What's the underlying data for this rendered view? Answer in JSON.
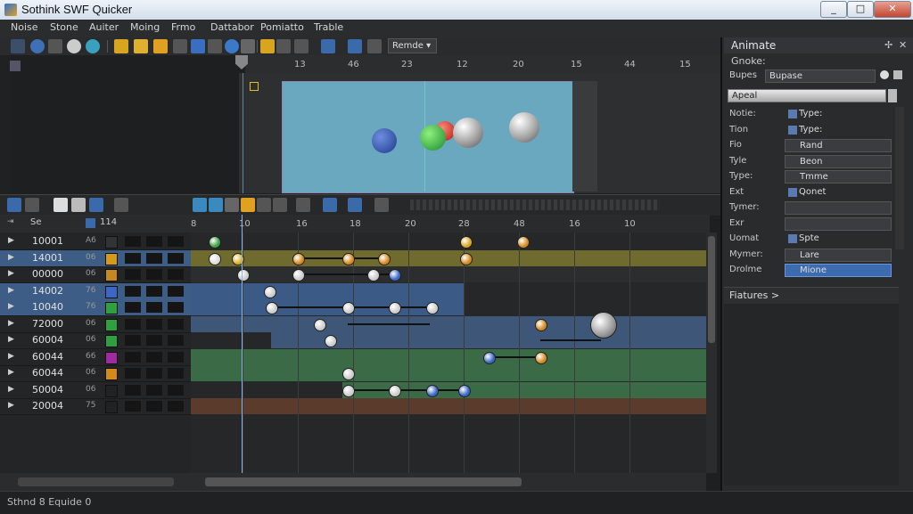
{
  "window": {
    "title": "Sothink SWF Quicker",
    "min": "_",
    "max": "□",
    "close": "✕"
  },
  "menu": [
    "Noise",
    "Stone",
    "Auiter",
    "Moing",
    "Frmo",
    "Dattabor",
    "Pomiatto",
    "Trable"
  ],
  "toolbar": {
    "render_dropdown": "Remde"
  },
  "ruler": {
    "labels": [
      "13",
      "46",
      "23",
      "12",
      "20",
      "15",
      "44",
      "15"
    ]
  },
  "timeline": {
    "ruler_labels": [
      "8",
      "10",
      "16",
      "18",
      "20",
      "28",
      "48",
      "16",
      "10"
    ],
    "layer_header": {
      "col1": "Se",
      "col2": "114"
    }
  },
  "layers": [
    {
      "name": "10001",
      "ab": "A6",
      "color": "#333333",
      "selected": false
    },
    {
      "name": "14001",
      "ab": "06",
      "color": "#d49a1a",
      "selected": true
    },
    {
      "name": "00000",
      "ab": "06",
      "color": "#c48a20",
      "selected": false
    },
    {
      "name": "14002",
      "ab": "76",
      "color": "#3a66c6",
      "selected": true
    },
    {
      "name": "10040",
      "ab": "76",
      "color": "#2ea040",
      "selected": true
    },
    {
      "name": "72000",
      "ab": "06",
      "color": "#2ea040",
      "selected": false
    },
    {
      "name": "60004",
      "ab": "06",
      "color": "#2ea040",
      "selected": false
    },
    {
      "name": "60044",
      "ab": "66",
      "color": "#a02aa0",
      "selected": false
    },
    {
      "name": "60044",
      "ab": "06",
      "color": "#d48a1a",
      "selected": false
    },
    {
      "name": "50004",
      "ab": "06",
      "color": "#222222",
      "selected": false
    },
    {
      "name": "20004",
      "ab": "75",
      "color": "#222222",
      "selected": false
    }
  ],
  "right_panel": {
    "title": "Animate",
    "subtitle": "Gnoke:",
    "preset_label": "Bupes",
    "preset_value": "Bupase",
    "speed": "Apeal",
    "props": [
      {
        "k": "Notie:",
        "v": "Type:",
        "style": "plain"
      },
      {
        "k": "Tion",
        "v": "Type:",
        "style": "plain"
      },
      {
        "k": "Fio",
        "v": "Rand",
        "style": "box"
      },
      {
        "k": "Tyle",
        "v": "Beon",
        "style": "box"
      },
      {
        "k": "Type:",
        "v": "Tmme",
        "style": "box"
      },
      {
        "k": "Ext",
        "v": "Qonet",
        "style": "plain"
      },
      {
        "k": "Tymer:",
        "v": "",
        "style": "box"
      },
      {
        "k": "Exr",
        "v": "",
        "style": "box"
      },
      {
        "k": "Uomat",
        "v": "Spte",
        "style": "plain"
      },
      {
        "k": "Mymer:",
        "v": "Lare",
        "style": "box"
      },
      {
        "k": "Drolme",
        "v": "Mione",
        "style": "hl"
      }
    ],
    "features": "Fiatures >"
  },
  "status": {
    "text": "Sthnd 8 Equide 0"
  }
}
